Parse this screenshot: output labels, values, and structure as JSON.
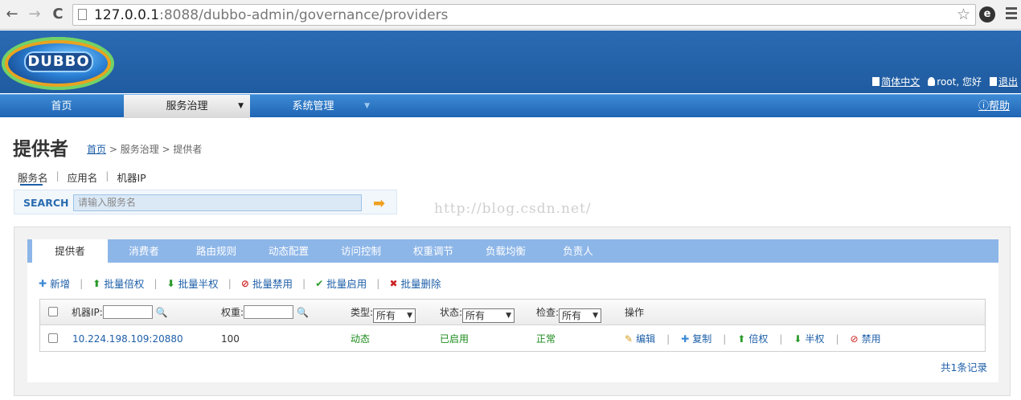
{
  "browser": {
    "url_host": "127.0.0.1",
    "url_rest": ":8088/dubbo-admin/governance/providers",
    "back": "←",
    "forward": "→",
    "reload": "C",
    "star": "☆",
    "ext": "e"
  },
  "header": {
    "logo": "DUBBO",
    "lang": "简体中文",
    "user": "root, 您好",
    "logout": "退出"
  },
  "nav": {
    "items": [
      "首页",
      "服务治理",
      "系统管理"
    ],
    "caret": "▼",
    "help": "帮助"
  },
  "page": {
    "title": "提供者",
    "crumb_home": "首页",
    "crumb_rest": " > 服务治理 > 提供者"
  },
  "search": {
    "tabs": [
      "服务名",
      "应用名",
      "机器IP"
    ],
    "sep": "|",
    "label": "SEARCH",
    "placeholder": "请输入服务名",
    "go": "➡"
  },
  "watermark": "http://blog.csdn.net/",
  "panel": {
    "tabs": [
      "提供者",
      "消费者",
      "路由规则",
      "动态配置",
      "访问控制",
      "权重调节",
      "负载均衡",
      "负责人"
    ],
    "actions": [
      {
        "icon": "✚",
        "label": "新增"
      },
      {
        "icon": "⬆",
        "label": "批量倍权"
      },
      {
        "icon": "⬇",
        "label": "批量半权"
      },
      {
        "icon": "⊘",
        "label": "批量禁用"
      },
      {
        "icon": "✔",
        "label": "批量启用"
      },
      {
        "icon": "✖",
        "label": "批量删除"
      }
    ],
    "table": {
      "ip_label": "机器IP:",
      "weight_label": "权重:",
      "type_label": "类型:",
      "type_value": "所有",
      "status_label": "状态:",
      "status_value": "所有",
      "check_label": "检查:",
      "check_value": "所有",
      "ops_label": "操作",
      "row": {
        "ip": "10.224.198.109:20880",
        "weight": "100",
        "type": "动态",
        "status": "已启用",
        "check": "正常",
        "ops": [
          {
            "icon": "✎",
            "label": "编辑"
          },
          {
            "icon": "✚",
            "label": "复制"
          },
          {
            "icon": "⬆",
            "label": "倍权"
          },
          {
            "icon": "⬇",
            "label": "半权"
          },
          {
            "icon": "⊘",
            "label": "禁用"
          }
        ]
      }
    },
    "total": "共1条记录"
  },
  "colors": {
    "brand_blue": "#1f5ba0",
    "tab_blue": "#8db6e8",
    "link_blue": "#1e5fa8",
    "ok_green": "#1a8a1a",
    "danger_red": "#cc2222"
  }
}
